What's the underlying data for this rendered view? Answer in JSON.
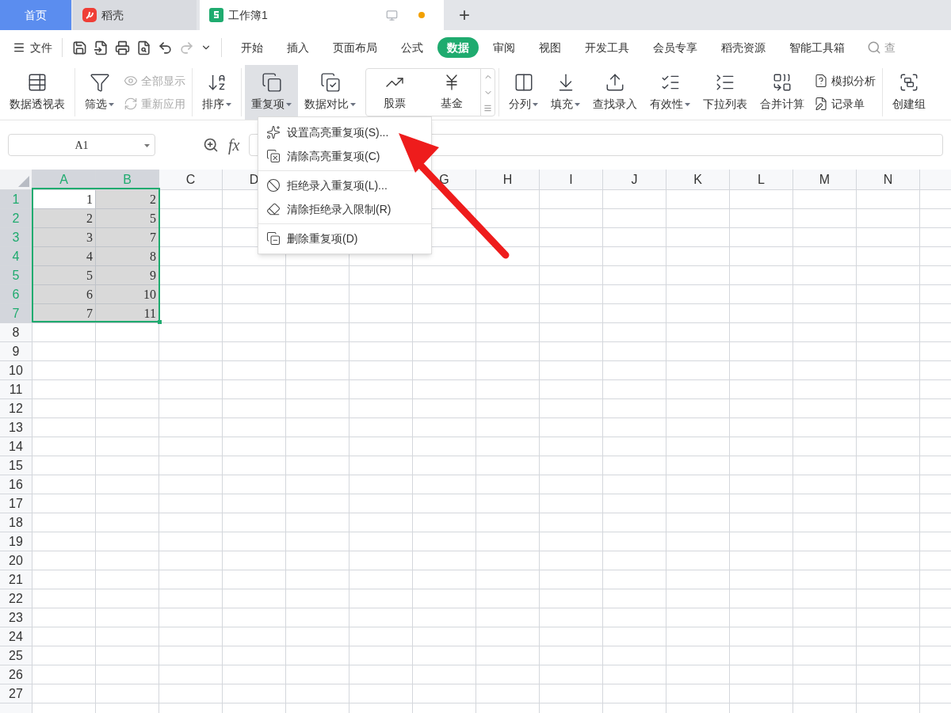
{
  "title_tabs": [
    {
      "label": "首页",
      "kind": "home",
      "selected": false
    },
    {
      "label": "稻壳",
      "kind": "docer",
      "selected": false
    },
    {
      "label": "工作簿1",
      "kind": "sheet",
      "selected": true,
      "unsaved": true
    }
  ],
  "new_tab": "+",
  "file_menu": "文件",
  "menu_tabs": [
    {
      "label": "开始",
      "selected": false
    },
    {
      "label": "插入",
      "selected": false
    },
    {
      "label": "页面布局",
      "selected": false
    },
    {
      "label": "公式",
      "selected": false
    },
    {
      "label": "数据",
      "selected": true
    },
    {
      "label": "审阅",
      "selected": false
    },
    {
      "label": "视图",
      "selected": false
    },
    {
      "label": "开发工具",
      "selected": false
    },
    {
      "label": "会员专享",
      "selected": false
    },
    {
      "label": "稻壳资源",
      "selected": false
    },
    {
      "label": "智能工具箱",
      "selected": false
    }
  ],
  "search": {
    "placeholder": "查"
  },
  "ribbon": [
    {
      "kind": "large",
      "label": "数据透视表",
      "dropdown": false,
      "pressed": false
    },
    {
      "kind": "separator"
    },
    {
      "kind": "large",
      "label": "筛选",
      "dropdown": true,
      "pressed": false
    },
    {
      "kind": "stack",
      "items": [
        {
          "label": "全部显示",
          "disabled": true
        },
        {
          "label": "重新应用",
          "disabled": true
        }
      ]
    },
    {
      "kind": "separator"
    },
    {
      "kind": "large",
      "label": "排序",
      "dropdown": true,
      "pressed": false
    },
    {
      "kind": "separator"
    },
    {
      "kind": "large",
      "label": "重复项",
      "dropdown": true,
      "pressed": true
    },
    {
      "kind": "large",
      "label": "数据对比",
      "dropdown": true,
      "pressed": false
    },
    {
      "kind": "gallery",
      "items": [
        "股票",
        "基金"
      ]
    },
    {
      "kind": "separator"
    },
    {
      "kind": "large",
      "label": "分列",
      "dropdown": true,
      "pressed": false
    },
    {
      "kind": "large",
      "label": "填充",
      "dropdown": true,
      "pressed": false
    },
    {
      "kind": "large",
      "label": "查找录入",
      "dropdown": false,
      "pressed": false
    },
    {
      "kind": "large",
      "label": "有效性",
      "dropdown": true,
      "pressed": false
    },
    {
      "kind": "large",
      "label": "下拉列表",
      "dropdown": false,
      "pressed": false
    },
    {
      "kind": "large",
      "label": "合并计算",
      "dropdown": false,
      "pressed": false
    },
    {
      "kind": "stack",
      "items": [
        {
          "label": "模拟分析",
          "disabled": false
        },
        {
          "label": "记录单",
          "disabled": false
        }
      ]
    },
    {
      "kind": "separator"
    },
    {
      "kind": "large",
      "label": "创建组",
      "dropdown": false,
      "pressed": false
    }
  ],
  "name_box": "A1",
  "fx": "fx",
  "dropdown_menu": [
    [
      {
        "label": "设置高亮重复项(S)..."
      },
      {
        "label": "清除高亮重复项(C)"
      }
    ],
    [
      {
        "label": "拒绝录入重复项(L)..."
      },
      {
        "label": "清除拒绝录入限制(R)"
      }
    ],
    [
      {
        "label": "删除重复项(D)"
      }
    ]
  ],
  "sheet": {
    "columns": [
      {
        "label": "A",
        "selected": true
      },
      {
        "label": "B",
        "selected": true
      },
      {
        "label": "C",
        "selected": false
      },
      {
        "label": "D",
        "selected": false
      },
      {
        "label": "G",
        "selected": false
      },
      {
        "label": "H",
        "selected": false
      },
      {
        "label": "I",
        "selected": false
      },
      {
        "label": "J",
        "selected": false
      },
      {
        "label": "K",
        "selected": false
      },
      {
        "label": "L",
        "selected": false
      },
      {
        "label": "M",
        "selected": false
      },
      {
        "label": "N",
        "selected": false
      }
    ],
    "rows": [
      {
        "label": "1",
        "selected": true,
        "cells": [
          {
            "value": "1",
            "highlighted": false
          },
          {
            "value": "2",
            "highlighted": true
          }
        ]
      },
      {
        "label": "2",
        "selected": true,
        "cells": [
          {
            "value": "2",
            "highlighted": true
          },
          {
            "value": "5",
            "highlighted": true
          }
        ]
      },
      {
        "label": "3",
        "selected": true,
        "cells": [
          {
            "value": "3",
            "highlighted": true
          },
          {
            "value": "7",
            "highlighted": true
          }
        ]
      },
      {
        "label": "4",
        "selected": true,
        "cells": [
          {
            "value": "4",
            "highlighted": true
          },
          {
            "value": "8",
            "highlighted": true
          }
        ]
      },
      {
        "label": "5",
        "selected": true,
        "cells": [
          {
            "value": "5",
            "highlighted": true
          },
          {
            "value": "9",
            "highlighted": true
          }
        ]
      },
      {
        "label": "6",
        "selected": true,
        "cells": [
          {
            "value": "6",
            "highlighted": true
          },
          {
            "value": "10",
            "highlighted": true
          }
        ]
      },
      {
        "label": "7",
        "selected": true,
        "cells": [
          {
            "value": "7",
            "highlighted": true
          },
          {
            "value": "11",
            "highlighted": true
          }
        ]
      },
      {
        "label": "8",
        "selected": false,
        "cells": []
      },
      {
        "label": "9",
        "selected": false,
        "cells": []
      },
      {
        "label": "10",
        "selected": false,
        "cells": []
      },
      {
        "label": "11",
        "selected": false,
        "cells": []
      },
      {
        "label": "12",
        "selected": false,
        "cells": []
      },
      {
        "label": "13",
        "selected": false,
        "cells": []
      },
      {
        "label": "14",
        "selected": false,
        "cells": []
      },
      {
        "label": "15",
        "selected": false,
        "cells": []
      },
      {
        "label": "16",
        "selected": false,
        "cells": []
      },
      {
        "label": "17",
        "selected": false,
        "cells": []
      },
      {
        "label": "18",
        "selected": false,
        "cells": []
      },
      {
        "label": "19",
        "selected": false,
        "cells": []
      },
      {
        "label": "20",
        "selected": false,
        "cells": []
      },
      {
        "label": "21",
        "selected": false,
        "cells": []
      },
      {
        "label": "22",
        "selected": false,
        "cells": []
      },
      {
        "label": "23",
        "selected": false,
        "cells": []
      },
      {
        "label": "24",
        "selected": false,
        "cells": []
      },
      {
        "label": "25",
        "selected": false,
        "cells": []
      },
      {
        "label": "26",
        "selected": false,
        "cells": []
      },
      {
        "label": "27",
        "selected": false,
        "cells": []
      }
    ]
  }
}
